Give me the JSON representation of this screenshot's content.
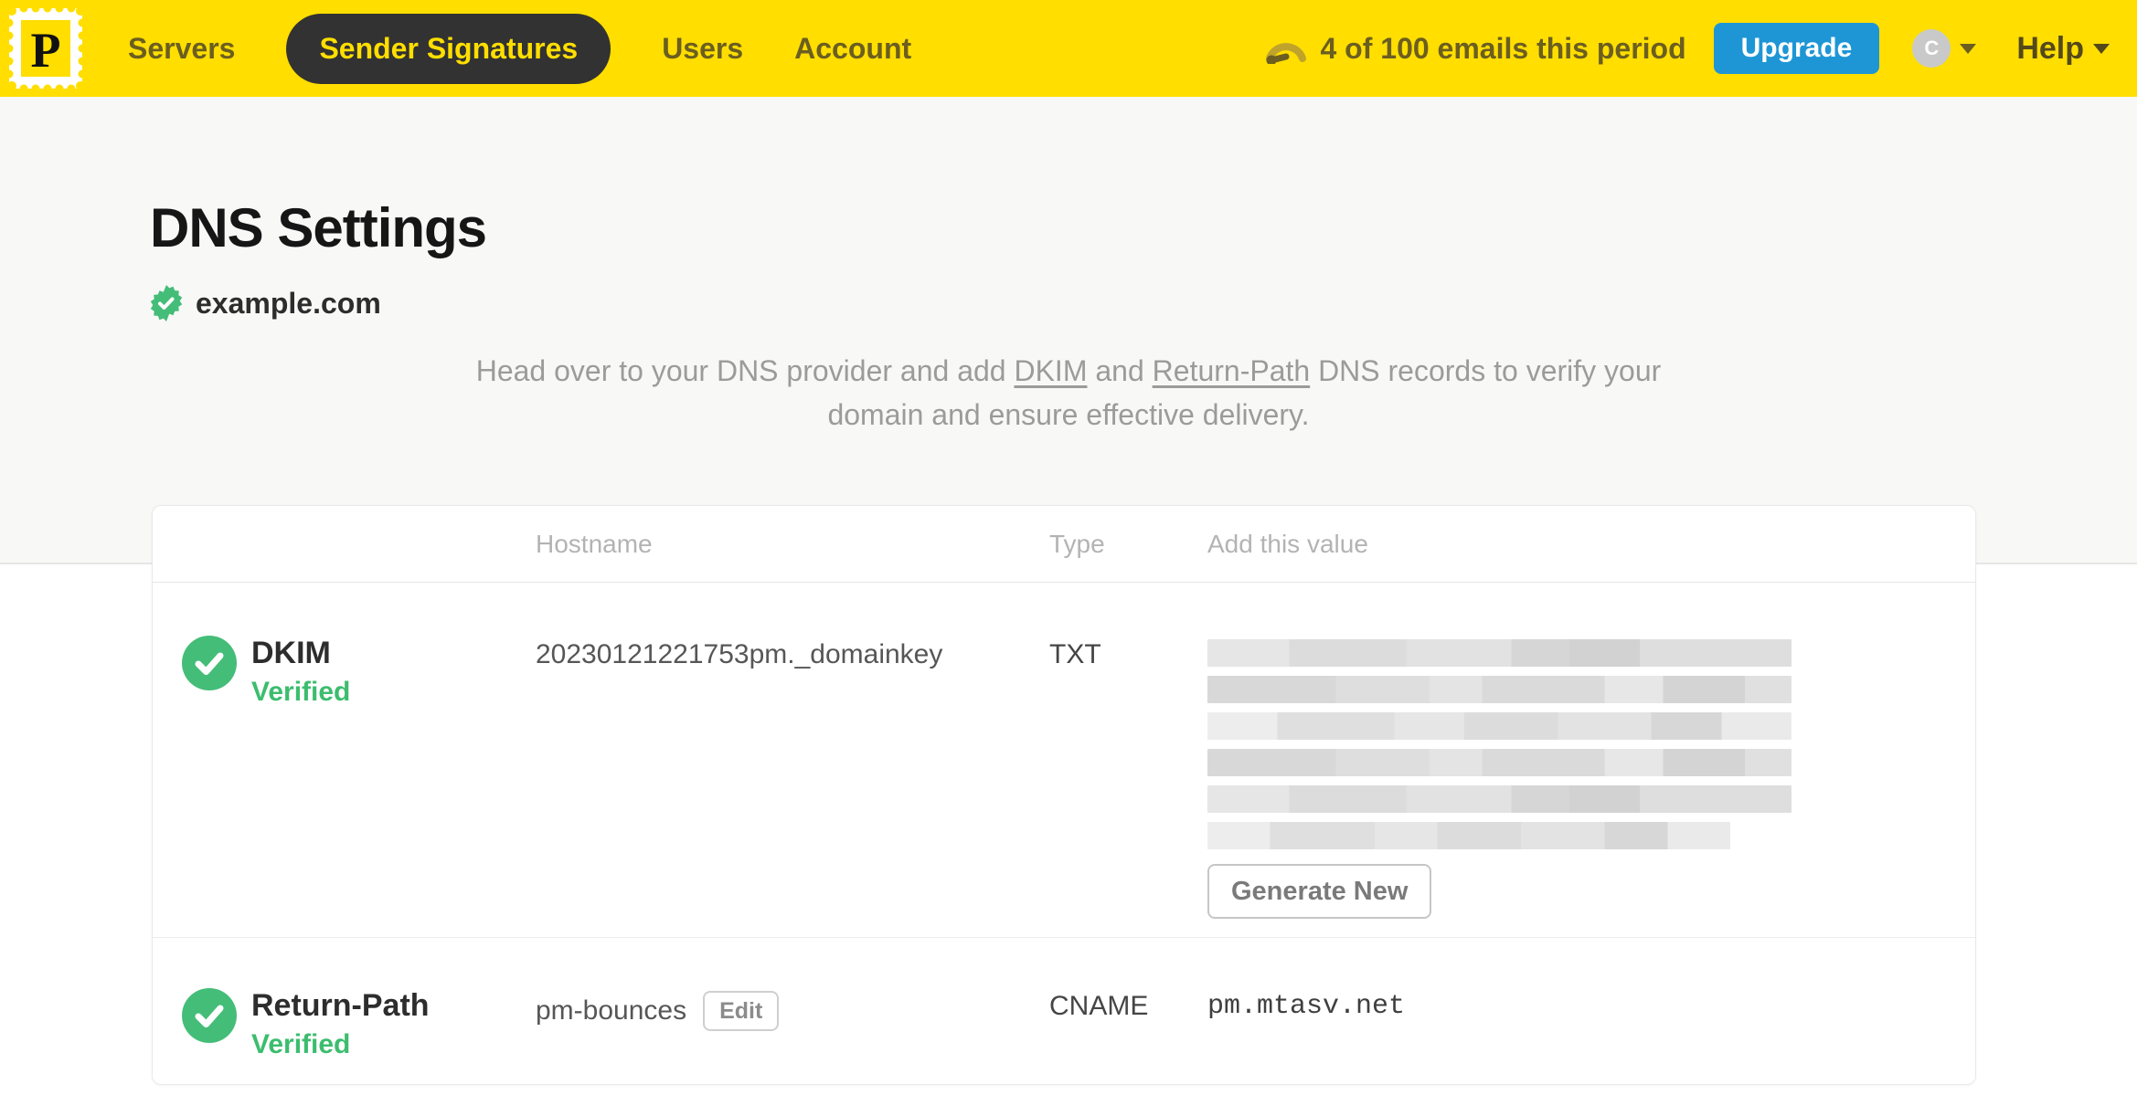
{
  "header": {
    "logo_letter": "P",
    "nav": [
      {
        "label": "Servers"
      },
      {
        "label": "Sender Signatures"
      },
      {
        "label": "Users"
      },
      {
        "label": "Account"
      }
    ],
    "usage_text": "4 of 100 emails this period",
    "upgrade_label": "Upgrade",
    "avatar_initial": "C",
    "help_label": "Help"
  },
  "page": {
    "title": "DNS Settings",
    "domain": "example.com",
    "instruction": {
      "part1": "Head over to your DNS provider and add ",
      "link_dkim": "DKIM",
      "part2": " and ",
      "link_return_path": "Return-Path",
      "part3": " DNS records to verify your domain and ensure effective delivery."
    }
  },
  "table": {
    "columns": {
      "hostname": "Hostname",
      "type": "Type",
      "value": "Add this value"
    },
    "rows": [
      {
        "name": "DKIM",
        "status": "Verified",
        "hostname": "20230121221753pm._domainkey",
        "type": "TXT",
        "value_redacted": true,
        "action_label": "Generate New"
      },
      {
        "name": "Return-Path",
        "status": "Verified",
        "hostname": "pm-bounces",
        "edit_label": "Edit",
        "type": "CNAME",
        "value": "pm.mtasv.net"
      }
    ]
  },
  "colors": {
    "brand_yellow": "#ffde00",
    "nav_text": "#6b5e20",
    "active_pill_bg": "#323232",
    "upgrade_blue": "#1e96d6",
    "verified_green": "#3cbd6e",
    "title_black": "#161616"
  }
}
